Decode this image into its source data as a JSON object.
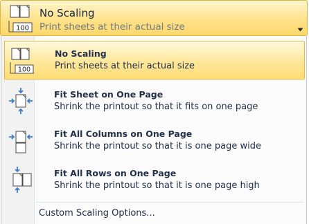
{
  "header": {
    "title": "No Scaling",
    "description": "Print sheets at their actual size",
    "icon": "no-scaling-icon",
    "badge": "100",
    "arrow_icon": "dropdown-arrow-icon"
  },
  "menu": {
    "items": [
      {
        "title": "No Scaling",
        "description": "Print sheets at their actual size",
        "icon": "no-scaling-icon",
        "badge": "100",
        "selected": true
      },
      {
        "title": "Fit Sheet on One Page",
        "description": "Shrink the printout so that it fits on one page",
        "icon": "fit-sheet-icon",
        "selected": false
      },
      {
        "title": "Fit All Columns on One Page",
        "description": "Shrink the printout so that it is one page wide",
        "icon": "fit-columns-icon",
        "selected": false
      },
      {
        "title": "Fit All Rows on One Page",
        "description": "Shrink the printout so that it is one page high",
        "icon": "fit-rows-icon",
        "selected": false
      }
    ],
    "custom_label": "Custom Scaling Options..."
  },
  "colors": {
    "highlight_border": "#e5bb44",
    "highlight_fill": "#ffe79a",
    "text": "#22304a",
    "icon_blue": "#3b7bd0"
  }
}
